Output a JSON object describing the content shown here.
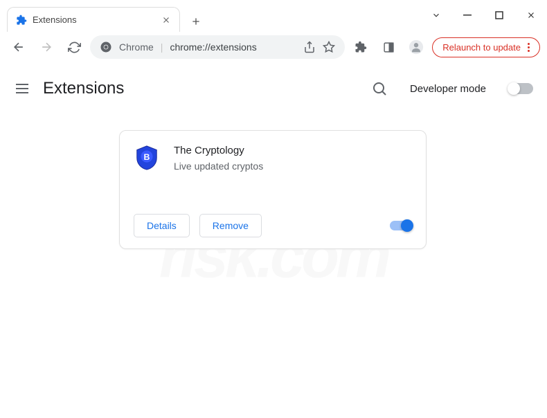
{
  "tab": {
    "title": "Extensions"
  },
  "omnibox": {
    "scheme_label": "Chrome",
    "url": "chrome://extensions"
  },
  "relaunch": {
    "label": "Relaunch to update"
  },
  "page": {
    "title": "Extensions",
    "dev_mode_label": "Developer mode",
    "dev_mode_on": false
  },
  "extension": {
    "name": "The Cryptology",
    "description": "Live updated cryptos",
    "details_label": "Details",
    "remove_label": "Remove",
    "enabled": true
  }
}
